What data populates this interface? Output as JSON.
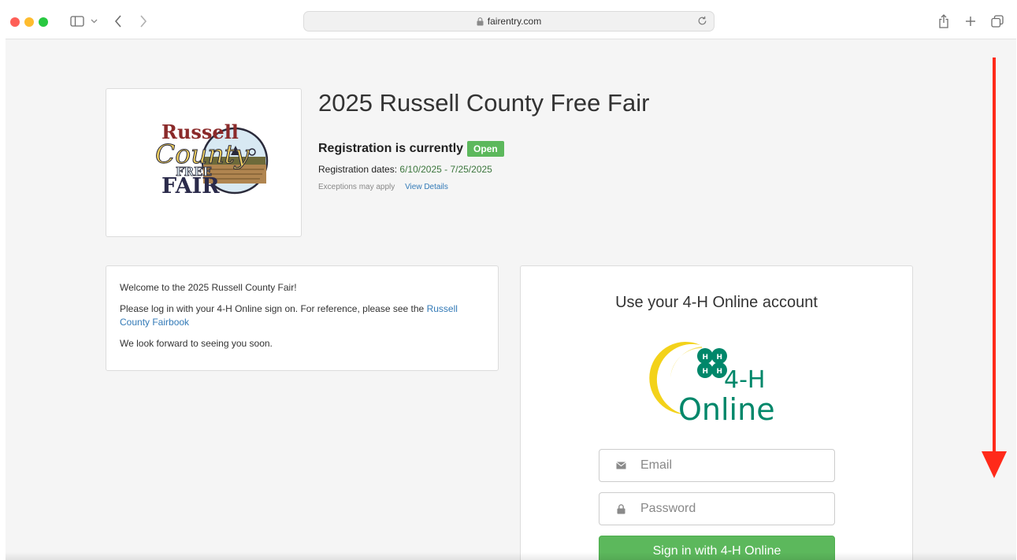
{
  "browser": {
    "url": "fairentry.com"
  },
  "fair": {
    "title": "2025 Russell County Free Fair",
    "logo_text": [
      "Russell",
      "County",
      "FREE",
      "FAIR"
    ],
    "registration_label": "Registration is currently",
    "registration_status": "Open",
    "dates_label": "Registration dates:",
    "dates_value": "6/10/2025 - 7/25/2025",
    "exceptions_text": "Exceptions may apply",
    "view_details": "View Details"
  },
  "welcome": {
    "line1": "Welcome to the 2025 Russell County Fair!",
    "line2_prefix": "Please log in with your 4-H Online sign on. For reference, please see the",
    "fairbook_link": "Russell County Fairbook",
    "line3": "We look forward to seeing you soon."
  },
  "login": {
    "heading": "Use your 4-H Online account",
    "logo_text": [
      "4-H",
      "Online"
    ],
    "email_placeholder": "Email",
    "password_placeholder": "Password",
    "signin_label": "Sign in with 4-H Online"
  },
  "colors": {
    "open_badge": "#5cb85c",
    "link": "#337ab7",
    "dates_green": "#3c763d",
    "fourh_green": "#00876a",
    "annotation_arrow": "#ff2a1a"
  },
  "icons": [
    "sidebar-icon",
    "chevron-down-icon",
    "back-icon",
    "forward-icon",
    "lock-icon",
    "reload-icon",
    "share-icon",
    "plus-icon",
    "tabs-icon",
    "envelope-icon",
    "password-lock-icon",
    "down-arrow-icon"
  ]
}
